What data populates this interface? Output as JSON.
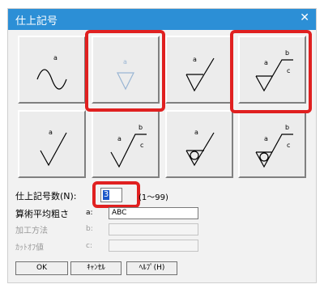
{
  "dialog": {
    "title": "仕上記号",
    "close_icon": "close-icon"
  },
  "symbols": [
    {
      "name": "finish-symbol-wavy",
      "label_a": "a"
    },
    {
      "name": "finish-symbol-triangle",
      "label_a": "a"
    },
    {
      "name": "finish-symbol-triangle-check",
      "label_a": "a"
    },
    {
      "name": "finish-symbol-triangle-check-bc",
      "label_a": "a",
      "label_b": "b",
      "label_c": "c"
    },
    {
      "name": "finish-symbol-check",
      "label_a": "a"
    },
    {
      "name": "finish-symbol-check-bc",
      "label_a": "a",
      "label_b": "b",
      "label_c": "c"
    },
    {
      "name": "finish-symbol-circle-check",
      "label_a": "a"
    },
    {
      "name": "finish-symbol-circle-check-bc",
      "label_a": "a",
      "label_b": "b",
      "label_c": "c"
    }
  ],
  "form": {
    "count_label": "仕上記号数(N):",
    "count_value": "3",
    "count_range": "(1〜99)",
    "roughness_label": "算術平均粗さ",
    "roughness_key": "a:",
    "roughness_value": "ABC",
    "method_label": "加工方法",
    "method_key": "b:",
    "method_value": "",
    "cutoff_label": "ｶｯﾄｵﾌ値",
    "cutoff_key": "c:",
    "cutoff_value": ""
  },
  "buttons": {
    "ok": "OK",
    "cancel": "ｷｬﾝｾﾙ",
    "help": "ﾍﾙﾌﾟ(H)"
  },
  "colors": {
    "titlebar": "#2c8fd6",
    "highlight": "#e02020"
  }
}
